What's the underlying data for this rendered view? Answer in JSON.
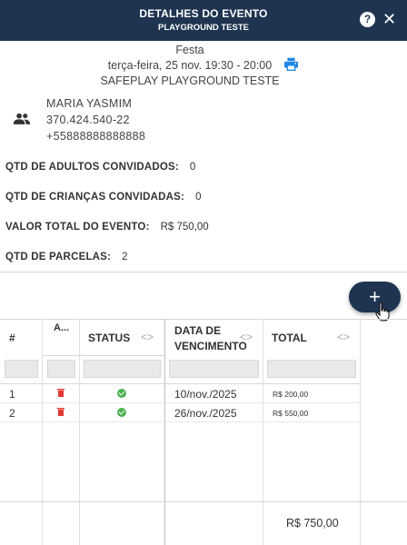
{
  "header": {
    "title": "DETALHES DO EVENTO",
    "subtitle": "PLAYGROUND TESTE",
    "help_label": "?",
    "close_label": "✕"
  },
  "event": {
    "type": "Festa",
    "datetime": "terça-feira, 25 nov. 19:30 - 20:00",
    "location": "SAFEPLAY PLAYGROUND TESTE"
  },
  "contact": {
    "name": "MARIA YASMIM",
    "document": "370.424.540-22",
    "phone": "+55888888888888"
  },
  "fields": [
    {
      "label": "QTD DE ADULTOS CONVIDADOS:",
      "value": "0"
    },
    {
      "label": "QTD DE CRIANÇAS CONVIDADAS:",
      "value": "0"
    },
    {
      "label": "VALOR TOTAL DO EVENTO:",
      "value": "R$ 750,00"
    },
    {
      "label": "QTD DE PARCELAS:",
      "value": "2"
    }
  ],
  "fab_label": "+",
  "table": {
    "columns": {
      "num": "#",
      "actions": "A...",
      "status": "STATUS",
      "due_line1": "DATA DE",
      "due_line2": "VENCIMENTO",
      "total": "TOTAL",
      "sort": "<>"
    },
    "rows": [
      {
        "num": "1",
        "due": "10/nov./2025",
        "total": "R$ 200,00",
        "status": "paid"
      },
      {
        "num": "2",
        "due": "26/nov./2025",
        "total": "R$ 550,00",
        "status": "paid"
      }
    ],
    "footer_total": "R$ 750,00"
  },
  "colors": {
    "header_bg": "#1f3450",
    "accent": "#1f3450",
    "print_icon": "#1e88e5",
    "delete_icon": "#e53935",
    "status_ok": "#4caf50"
  }
}
